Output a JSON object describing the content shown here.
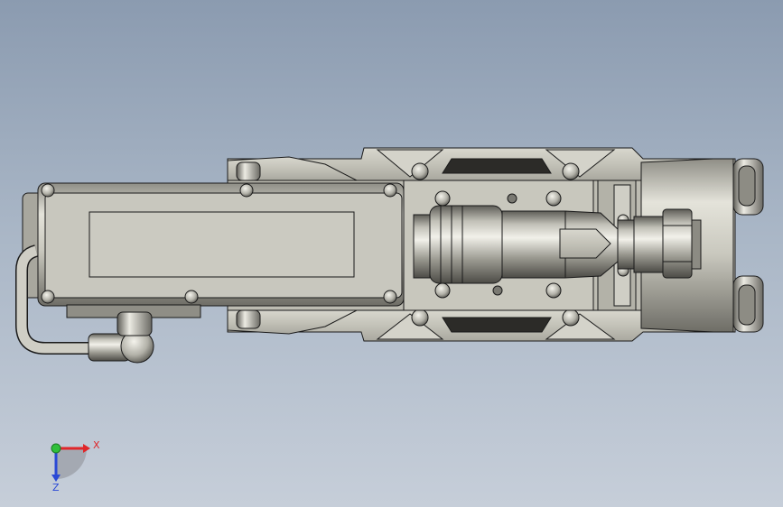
{
  "viewport": {
    "background_top": "#8b9bb0",
    "background_bottom": "#c6ced9",
    "part_color": "#bdbcb2",
    "edge_color": "#1a1a1a"
  },
  "triad": {
    "x_label": "X",
    "z_label": "Z",
    "x_color": "#e0262a",
    "y_color": "#2fbf3a",
    "z_color": "#2a49d6"
  }
}
